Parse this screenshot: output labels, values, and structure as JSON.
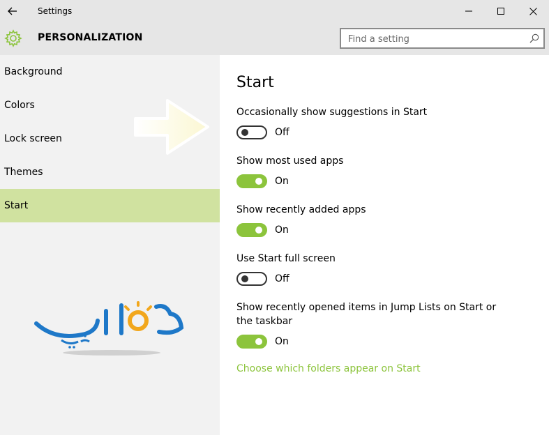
{
  "window": {
    "title": "Settings"
  },
  "header": {
    "title": "PERSONALIZATION",
    "search_placeholder": "Find a setting"
  },
  "sidebar": {
    "items": [
      {
        "label": "Background"
      },
      {
        "label": "Colors"
      },
      {
        "label": "Lock screen"
      },
      {
        "label": "Themes"
      },
      {
        "label": "Start",
        "active": true
      }
    ]
  },
  "main": {
    "title": "Start",
    "settings": [
      {
        "label": "Occasionally show suggestions in Start",
        "state": "Off",
        "on": false
      },
      {
        "label": "Show most used apps",
        "state": "On",
        "on": true
      },
      {
        "label": "Show recently added apps",
        "state": "On",
        "on": true
      },
      {
        "label": "Use Start full screen",
        "state": "Off",
        "on": false
      },
      {
        "label": "Show recently opened items in Jump Lists on Start or the taskbar",
        "state": "On",
        "on": true
      }
    ],
    "link": "Choose which folders appear on Start"
  },
  "colors": {
    "accent": "#8cc43c",
    "active_nav": "#d0e2a0",
    "titlebar": "#e6e6e6"
  },
  "icons": {
    "back": "back-arrow-icon",
    "gear": "gear-icon",
    "search": "search-icon",
    "minimize": "minimize-icon",
    "maximize": "maximize-icon",
    "close": "close-icon"
  }
}
